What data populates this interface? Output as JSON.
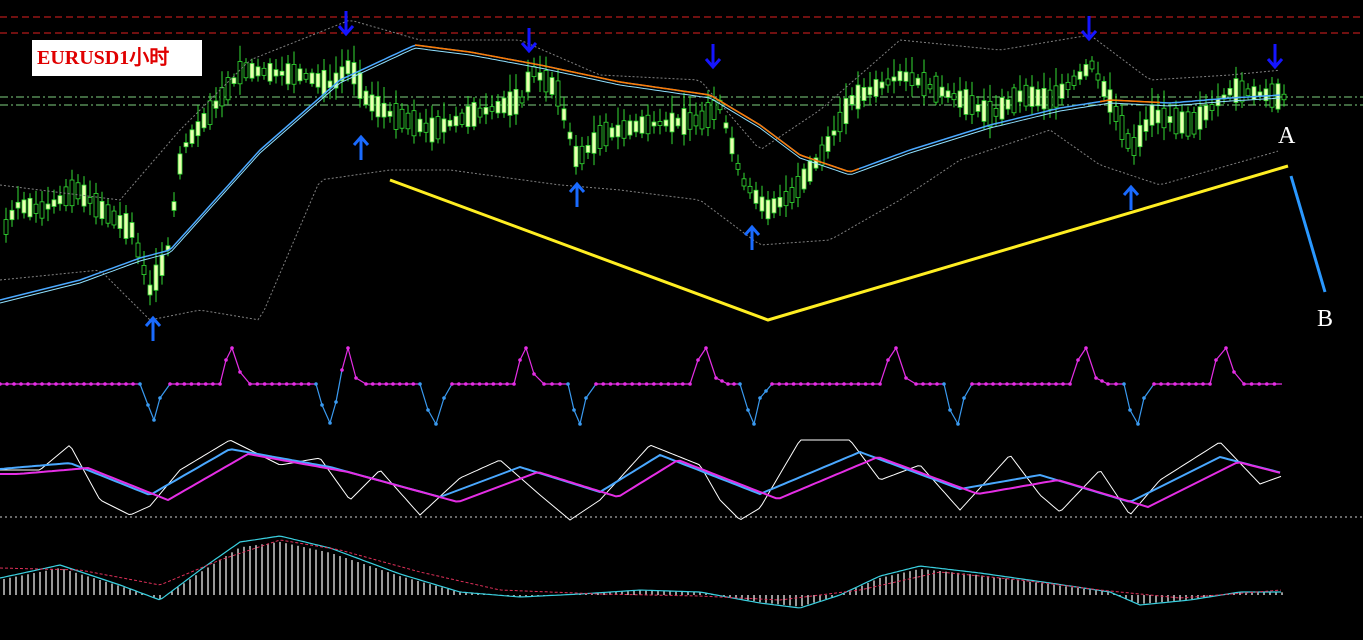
{
  "window": {
    "symbol_label": "EURUSD1小时"
  },
  "annotations": {
    "point_a": "A",
    "point_b": "B"
  },
  "colors": {
    "background": "#000000",
    "bull_candle": "#eaffb0",
    "candle_wick": "#33dd33",
    "ma_fast": "#4aa8ff",
    "ma_slow": "#ff7a00",
    "bollinger": "#808080",
    "resistance_line": "#e02020",
    "support_line": "#7fd07f",
    "trend_line": "#ffee22",
    "projection_line": "#2a98ff",
    "signal_arrow": "#1515ff",
    "signal_arrow_up": "#1a6bff",
    "zigzag_high": "#e52ee5",
    "zigzag_low": "#3a9af0",
    "stoch_main": "#ffffff",
    "stoch_signal": "#4aa8ff",
    "stoch_slow": "#e52ee5",
    "macd_hist": "#ffffff",
    "macd_main": "#3ad0e0",
    "macd_signal": "#e0305a"
  },
  "icons": {
    "signal_down": "arrow-down-icon",
    "signal_up": "arrow-up-icon"
  }
}
